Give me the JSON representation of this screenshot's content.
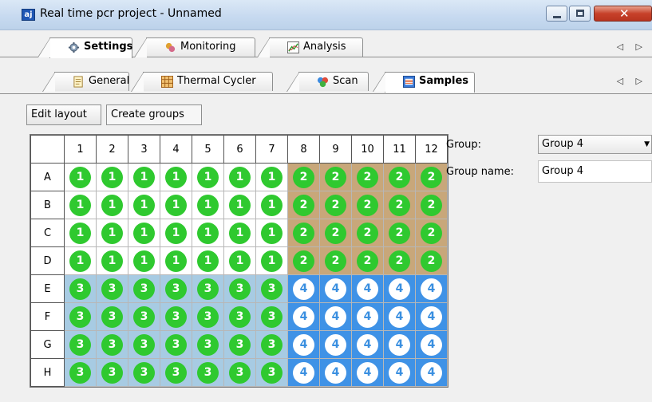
{
  "window": {
    "title": "Real time pcr project - Unnamed",
    "icon_label": "aj",
    "close_glyph": "✕"
  },
  "top_tabs": [
    {
      "label": "Settings",
      "icon": "gear-icon",
      "active": true
    },
    {
      "label": "Monitoring",
      "icon": "monitoring-icon",
      "active": false
    },
    {
      "label": "Analysis",
      "icon": "chart-icon",
      "active": false
    }
  ],
  "sub_tabs": [
    {
      "label": "General",
      "icon": "document-icon",
      "active": false
    },
    {
      "label": "Thermal Cycler",
      "icon": "thermal-cycler-icon",
      "active": false
    },
    {
      "label": "Scan",
      "icon": "scan-icon",
      "active": false
    },
    {
      "label": "Samples",
      "icon": "samples-icon",
      "active": true
    }
  ],
  "scroll_arrows": "◁ ▷",
  "buttons": {
    "edit_layout": "Edit layout",
    "create_groups": "Create groups"
  },
  "plate": {
    "columns": [
      "1",
      "2",
      "3",
      "4",
      "5",
      "6",
      "7",
      "8",
      "9",
      "10",
      "11",
      "12"
    ],
    "rows": [
      "A",
      "B",
      "C",
      "D",
      "E",
      "F",
      "G",
      "H"
    ],
    "groups": [
      {
        "number": "1",
        "rows": [
          "A",
          "B",
          "C",
          "D"
        ],
        "cols": [
          1,
          7
        ],
        "well_bg": "#ffffff",
        "disc": "green"
      },
      {
        "number": "2",
        "rows": [
          "A",
          "B",
          "C",
          "D"
        ],
        "cols": [
          8,
          12
        ],
        "well_bg": "#c8a77a",
        "disc": "green"
      },
      {
        "number": "3",
        "rows": [
          "E",
          "F",
          "G",
          "H"
        ],
        "cols": [
          1,
          7
        ],
        "well_bg": "#a7cbe3",
        "disc": "green"
      },
      {
        "number": "4",
        "rows": [
          "E",
          "F",
          "G",
          "H"
        ],
        "cols": [
          8,
          12
        ],
        "well_bg": "#3f92e6",
        "disc": "white"
      }
    ],
    "colors": {
      "green_disc": "#2fc92f",
      "white_disc_text": "#3a8fe0"
    }
  },
  "right_panel": {
    "group_label": "Group:",
    "group_value": "Group 4",
    "group_name_label": "Group name:",
    "group_name_value": "Group 4"
  }
}
